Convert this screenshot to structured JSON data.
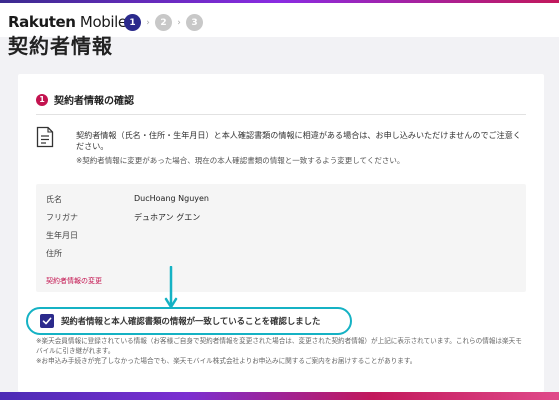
{
  "header": {
    "logo_bold": "Rakuten",
    "logo_regular": " Mobile",
    "steps": [
      "1",
      "2",
      "3"
    ],
    "current_step": 1
  },
  "page": {
    "title": "契約者情報"
  },
  "section": {
    "number": "1",
    "title": "契約者情報の確認"
  },
  "notice": {
    "main": "契約者情報（氏名・住所・生年月日）と本人確認書類の情報に相違がある場合は、お申し込みいただけませんのでご注意ください。",
    "sub": "※契約者情報に変更があった場合、現在の本人確認書類の情報と一致するよう変更してください。"
  },
  "contract_info": {
    "rows": [
      {
        "label": "氏名",
        "value": "DucHoang Nguyen"
      },
      {
        "label": "フリガナ",
        "value": "デュホアン グエン"
      },
      {
        "label": "生年月日",
        "value": ""
      },
      {
        "label": "住所",
        "value": ""
      }
    ],
    "change_link": "契約者情報の変更"
  },
  "confirmation": {
    "checked": true,
    "label": "契約者情報と本人確認書類の情報が一致していることを確認しました"
  },
  "footnotes": [
    "※楽天会員情報に登録されている情報（お客様ご自身で契約者情報を変更された場合は、変更された契約者情報）が上記に表示されています。これらの情報は楽天モバイルに引き継がれます。",
    "※お申込み手続きが完了しなかった場合でも、楽天モバイル株式会社よりお申込みに関するご案内をお届けすることがあります。"
  ],
  "colors": {
    "brand_pink": "#c3134f",
    "brand_navy": "#2b2a8c",
    "highlight_cyan": "#15b2c4"
  },
  "icons": {
    "notice": "document-icon",
    "checkbox": "checkmark-icon",
    "annotation": "arrow-down-icon"
  }
}
